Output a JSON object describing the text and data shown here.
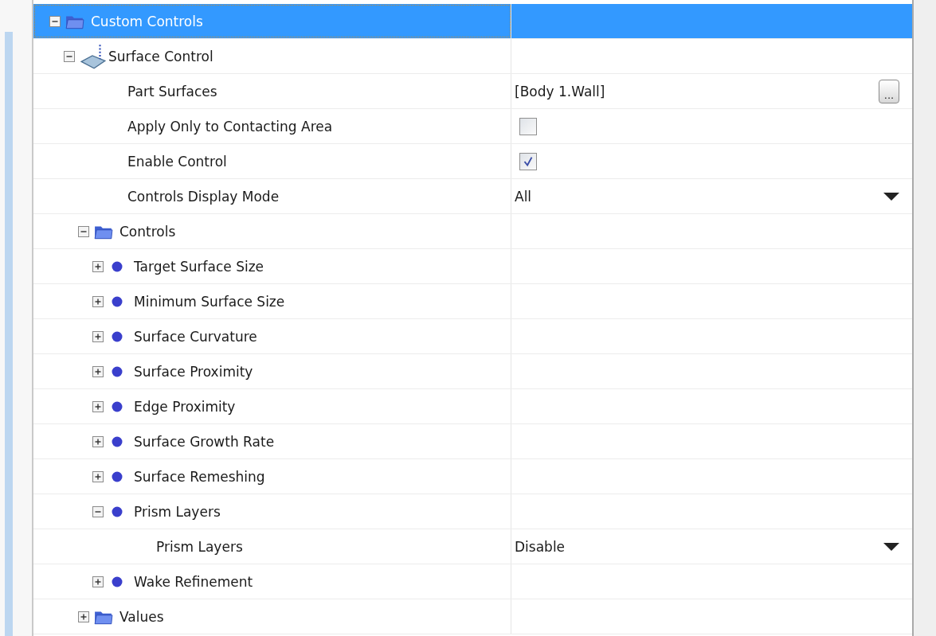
{
  "tree": [
    {
      "label": "Custom Controls",
      "kind": "folder",
      "expanded": true,
      "selected": true,
      "children": [
        {
          "label": "Surface Control",
          "kind": "surface",
          "expanded": true,
          "selected": false,
          "children": [
            {
              "label": "Part Surfaces",
              "selected": false,
              "value": {
                "kind": "browse",
                "text": "[Body 1.Wall]",
                "button": "..."
              }
            },
            {
              "label": "Apply Only to Contacting Area",
              "selected": false,
              "value": {
                "kind": "checkbox",
                "checked": false
              }
            },
            {
              "label": "Enable Control",
              "selected": false,
              "value": {
                "kind": "checkbox",
                "checked": true
              }
            },
            {
              "label": "Controls Display Mode",
              "selected": false,
              "value": {
                "kind": "dropdown",
                "text": "All"
              }
            },
            {
              "label": "Controls",
              "kind": "folder",
              "expanded": true,
              "selected": false,
              "children": [
                {
                  "label": "Target Surface Size",
                  "kind": "dot",
                  "expanded": false,
                  "selected": false
                },
                {
                  "label": "Minimum Surface Size",
                  "kind": "dot",
                  "expanded": false,
                  "selected": false
                },
                {
                  "label": "Surface Curvature",
                  "kind": "dot",
                  "expanded": false,
                  "selected": false
                },
                {
                  "label": "Surface Proximity",
                  "kind": "dot",
                  "expanded": false,
                  "selected": false
                },
                {
                  "label": "Edge Proximity",
                  "kind": "dot",
                  "expanded": false,
                  "selected": false
                },
                {
                  "label": "Surface Growth Rate",
                  "kind": "dot",
                  "expanded": false,
                  "selected": false
                },
                {
                  "label": "Surface Remeshing",
                  "kind": "dot",
                  "expanded": false,
                  "selected": false
                },
                {
                  "label": "Prism Layers",
                  "kind": "dot",
                  "expanded": true,
                  "selected": false,
                  "children": [
                    {
                      "label": "Prism Layers",
                      "selected": false,
                      "value": {
                        "kind": "dropdown",
                        "text": "Disable"
                      }
                    }
                  ]
                },
                {
                  "label": "Wake Refinement",
                  "kind": "dot",
                  "expanded": false,
                  "selected": false
                }
              ]
            },
            {
              "label": "Values",
              "kind": "folder",
              "expanded": false,
              "selected": false
            }
          ]
        }
      ]
    }
  ]
}
